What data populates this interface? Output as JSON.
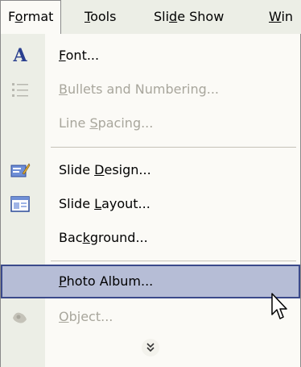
{
  "menubar": {
    "items": [
      {
        "pre": "F",
        "ul": "o",
        "post": "rmat",
        "active": true
      },
      {
        "pre": "",
        "ul": "T",
        "post": "ools",
        "active": false
      },
      {
        "pre": "Sli",
        "ul": "d",
        "post": "e Show",
        "active": false
      },
      {
        "pre": "",
        "ul": "W",
        "post": "in",
        "active": false
      }
    ]
  },
  "menu": {
    "items": [
      {
        "pre": "",
        "ul": "F",
        "post": "ont...",
        "icon": "font-a-icon",
        "disabled": false
      },
      {
        "pre": "",
        "ul": "B",
        "post": "ullets and Numbering...",
        "icon": "bullets-icon",
        "disabled": true
      },
      {
        "pre": "Line ",
        "ul": "S",
        "post": "pacing...",
        "icon": "",
        "disabled": true
      },
      {
        "pre": "Slide ",
        "ul": "D",
        "post": "esign...",
        "icon": "slide-design-icon",
        "disabled": false
      },
      {
        "pre": "Slide ",
        "ul": "L",
        "post": "ayout...",
        "icon": "slide-layout-icon",
        "disabled": false
      },
      {
        "pre": "Bac",
        "ul": "k",
        "post": "ground...",
        "icon": "",
        "disabled": false
      },
      {
        "pre": "",
        "ul": "P",
        "post": "hoto Album...",
        "icon": "",
        "disabled": false,
        "highlighted": true
      },
      {
        "pre": "",
        "ul": "O",
        "post": "bject...",
        "icon": "object-icon",
        "disabled": true
      }
    ],
    "expand_glyph": "❯"
  },
  "colors": {
    "highlight_bg": "#b6bdd6",
    "highlight_border": "#3b4a8b",
    "gutter": "#eceee6",
    "menu_bg": "#fbfaf6",
    "disabled_text": "#a8a69c"
  }
}
